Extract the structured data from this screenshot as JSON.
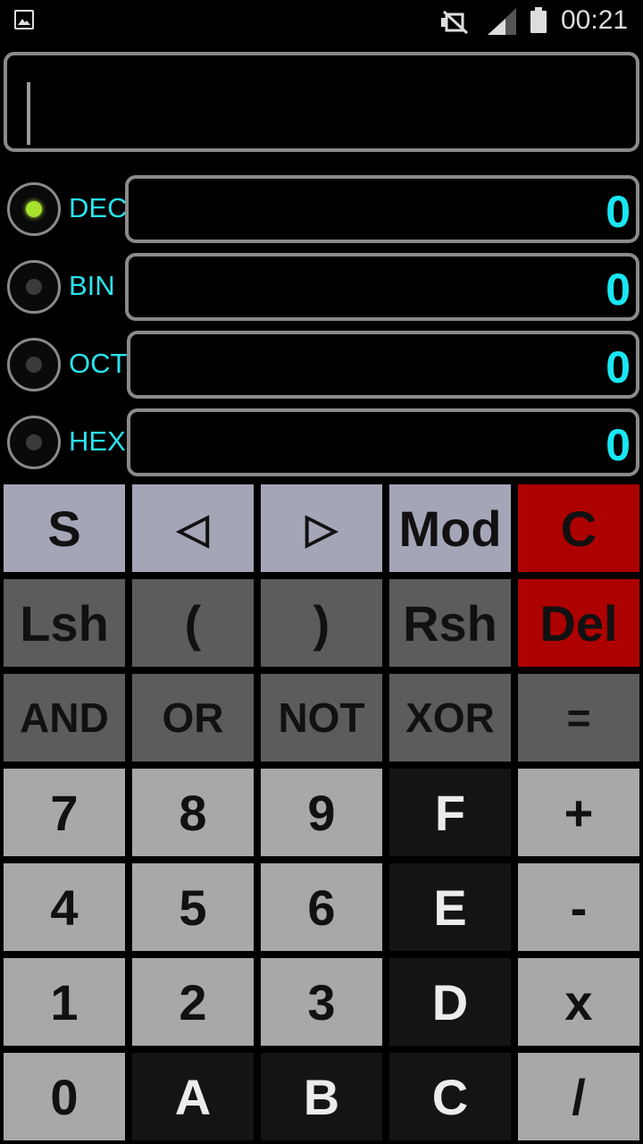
{
  "status_bar": {
    "time": "00:21",
    "icons": [
      "gallery-icon",
      "mute-icon",
      "signal-icon",
      "battery-icon"
    ]
  },
  "expression": {
    "value": ""
  },
  "bases": [
    {
      "label": "DEC",
      "value": "0",
      "selected": true
    },
    {
      "label": "BIN",
      "value": "0",
      "selected": false
    },
    {
      "label": "OCT",
      "value": "0",
      "selected": false
    },
    {
      "label": "HEX",
      "value": "0",
      "selected": false
    }
  ],
  "keypad": {
    "rows": [
      [
        "S",
        "◁",
        "▷",
        "Mod",
        "C"
      ],
      [
        "Lsh",
        "(",
        ")",
        "Rsh",
        "Del"
      ],
      [
        "AND",
        "OR",
        "NOT",
        "XOR",
        "="
      ],
      [
        "7",
        "8",
        "9",
        "F",
        "+"
      ],
      [
        "4",
        "5",
        "6",
        "E",
        "-"
      ],
      [
        "1",
        "2",
        "3",
        "D",
        "x"
      ],
      [
        "0",
        "A",
        "B",
        "C",
        "/"
      ]
    ]
  },
  "colors": {
    "accent_cyan": "#19e6f2",
    "radio_selected": "#a6e22e",
    "clear_key_red": "#ad0000",
    "function_key_lavender": "#a4a6b8",
    "operator_key_gray": "#5c5c5c",
    "digit_key_gray": "#a8a8a8",
    "hex_key_black": "#141414"
  }
}
